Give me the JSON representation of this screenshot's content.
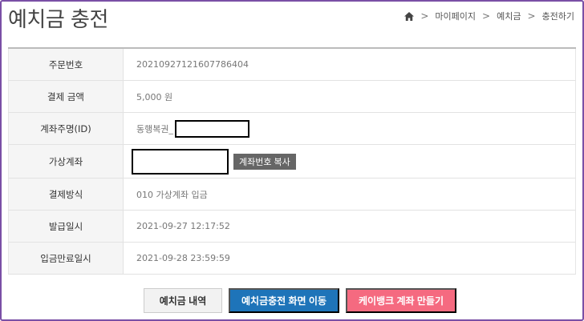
{
  "page": {
    "title": "예치금 충전"
  },
  "breadcrumb": {
    "items": [
      "마이페이지",
      "예치금",
      "충전하기"
    ]
  },
  "table": {
    "rows": [
      {
        "label": "주문번호",
        "value": "20210927121607786404"
      },
      {
        "label": "결제 금액",
        "value": "5,000 원"
      },
      {
        "label": "계좌주명(ID)",
        "value": "동행복권_"
      },
      {
        "label": "가상계좌",
        "value": ""
      },
      {
        "label": "결제방식",
        "value": "010 가상계좌 입금"
      },
      {
        "label": "발급일시",
        "value": "2021-09-27 12:17:52"
      },
      {
        "label": "입금만료일시",
        "value": "2021-09-28 23:59:59"
      }
    ]
  },
  "copy_button": {
    "label": "계좌번호 복사"
  },
  "actions": {
    "history": "예치금 내역",
    "move": "예치금충전 화면 이동",
    "kbank": "케이뱅크 계좌 만들기"
  },
  "colors": {
    "accent_red": "#d9534f",
    "primary_blue": "#1e74b9",
    "pink": "#f56a80",
    "frame": "#7a4fa6"
  }
}
